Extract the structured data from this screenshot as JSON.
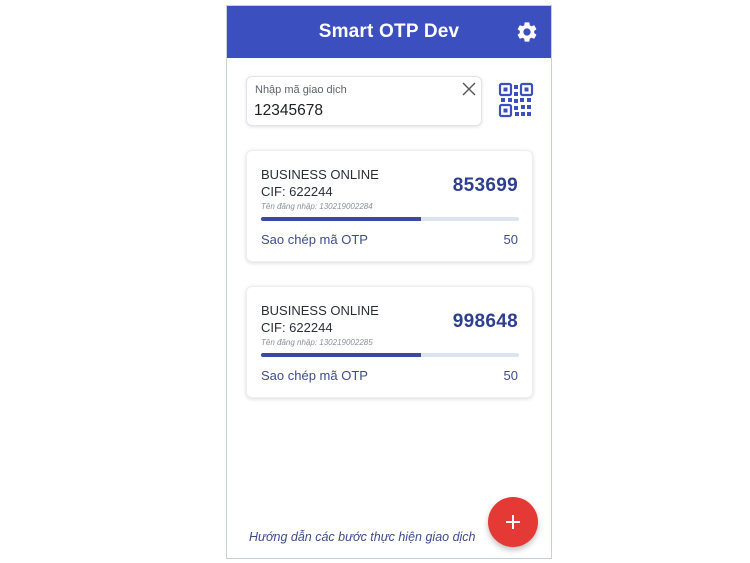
{
  "app": {
    "title": "Smart OTP Dev",
    "icons": {
      "settings": "gear-icon",
      "clear": "close-icon",
      "qr": "qr-code-icon",
      "add": "plus-icon"
    },
    "colors": {
      "header": "#3c4fbf",
      "otp_text": "#2f3f8f",
      "progress": "#3a4aa0",
      "fab": "#e53935"
    }
  },
  "transaction_input": {
    "label": "Nhập mã giao dịch",
    "value": "12345678"
  },
  "accounts": [
    {
      "service": "BUSINESS ONLINE",
      "cif": "CIF: 622244",
      "username": "Tên đăng nhập: 130219002284",
      "otp": "853699",
      "progress": 0.62,
      "copy_label": "Sao chép mã OTP",
      "countdown": "50"
    },
    {
      "service": "BUSINESS ONLINE",
      "cif": "CIF: 622244",
      "username": "Tên đăng nhập: 130219002285",
      "otp": "998648",
      "progress": 0.62,
      "copy_label": "Sao chép mã OTP",
      "countdown": "50"
    }
  ],
  "footer": {
    "guide_link": "Hướng dẫn các bước thực hiện giao dịch"
  }
}
